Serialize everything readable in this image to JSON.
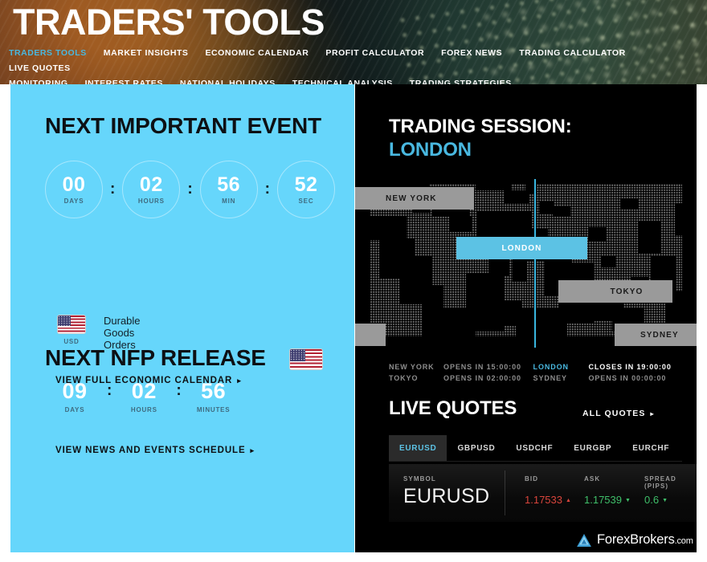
{
  "header": {
    "title": "TRADERS' TOOLS",
    "nav": [
      {
        "label": "TRADERS TOOLS",
        "active": true
      },
      {
        "label": "MARKET INSIGHTS",
        "active": false
      },
      {
        "label": "ECONOMIC CALENDAR",
        "active": false
      },
      {
        "label": "PROFIT CALCULATOR",
        "active": false
      },
      {
        "label": "FOREX NEWS",
        "active": false
      },
      {
        "label": "TRADING CALCULATOR",
        "active": false
      },
      {
        "label": "LIVE QUOTES",
        "active": false
      },
      {
        "label": "MONITORING",
        "active": false
      },
      {
        "label": "INTEREST RATES",
        "active": false
      },
      {
        "label": "NATIONAL HOLIDAYS",
        "active": false
      },
      {
        "label": "TECHNICAL ANALYSIS",
        "active": false
      },
      {
        "label": "TRADING STRATEGIES",
        "active": false
      }
    ],
    "accent_color": "#49b8e0"
  },
  "left_panel": {
    "background_color": "#66d6fb",
    "event_heading": "NEXT IMPORTANT EVENT",
    "countdown": [
      {
        "value": "00",
        "label": "DAYS"
      },
      {
        "value": "02",
        "label": "HOURS"
      },
      {
        "value": "56",
        "label": "MIN"
      },
      {
        "value": "52",
        "label": "SEC"
      }
    ],
    "separator": ":",
    "event": {
      "name": "Durable Goods Orders",
      "currency": "USD",
      "flag": "us-flag-icon"
    },
    "calendar_link": "VIEW FULL ECONOMIC CALENDAR",
    "nfp_heading": "NEXT NFP RELEASE",
    "nfp_flag": "us-flag-icon",
    "nfp_countdown": [
      {
        "value": "09",
        "label": "DAYS"
      },
      {
        "value": "02",
        "label": "HOURS"
      },
      {
        "value": "56",
        "label": "MINUTES"
      }
    ],
    "news_link": "VIEW NEWS AND EVENTS SCHEDULE",
    "link_arrow": "▸"
  },
  "right_panel": {
    "session_heading": "TRADING SESSION:",
    "session_city": "LONDON",
    "accent_color": "#49b8e0",
    "map_sessions": [
      {
        "name": "NEW YORK",
        "active": false
      },
      {
        "name": "LONDON",
        "active": true
      },
      {
        "name": "TOKYO",
        "active": false
      },
      {
        "name": "SYDNEY",
        "active": false
      }
    ],
    "session_table": [
      {
        "city": "NEW YORK",
        "status": "OPENS IN 15:00:00",
        "active": false
      },
      {
        "city": "LONDON",
        "status": "CLOSES IN 19:00:00",
        "active": true
      },
      {
        "city": "TOKYO",
        "status": "OPENS IN 02:00:00",
        "active": false
      },
      {
        "city": "SYDNEY",
        "status": "OPENS IN 00:00:00",
        "active": false
      }
    ],
    "quotes_title": "LIVE QUOTES",
    "all_quotes_link": "ALL QUOTES",
    "link_arrow": "▸",
    "tabs": [
      {
        "label": "EURUSD",
        "active": true
      },
      {
        "label": "GBPUSD",
        "active": false
      },
      {
        "label": "USDCHF",
        "active": false
      },
      {
        "label": "EURGBP",
        "active": false
      },
      {
        "label": "EURCHF",
        "active": false
      }
    ],
    "quote": {
      "symbol_label": "SYMBOL",
      "symbol": "EURUSD",
      "bid_label": "BID",
      "bid": "1.17533",
      "bid_dir": "▲",
      "bid_color": "#d9453c",
      "ask_label": "ASK",
      "ask": "1.17539",
      "ask_dir": "▼",
      "ask_color": "#3fbf6a",
      "spread_label": "SPREAD (PIPS)",
      "spread": "0.6",
      "spread_dir": "▼",
      "spread_color": "#3fbf6a"
    },
    "logo": {
      "name": "ForexBrokers",
      "domain": ".com",
      "mark": "forexbrokers-logo-icon"
    }
  }
}
